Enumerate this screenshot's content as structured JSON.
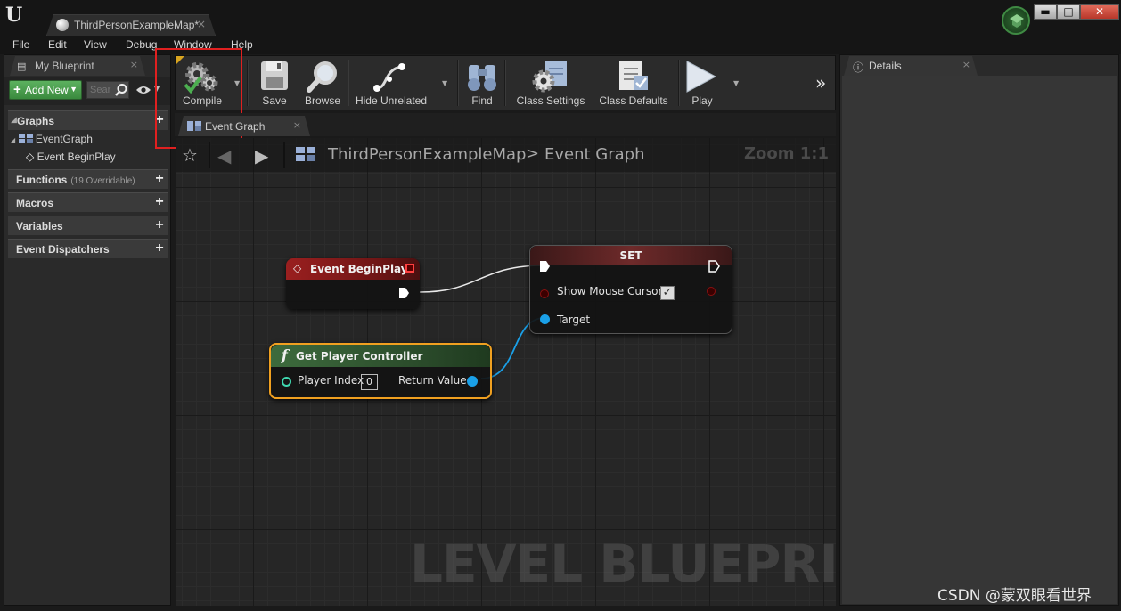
{
  "window": {
    "tab_title": "ThirdPersonExampleMap*",
    "tab_close": "×",
    "controls": {
      "minimize": "▬",
      "maximize": "□",
      "close": "✕"
    }
  },
  "menu": [
    "File",
    "Edit",
    "View",
    "Debug",
    "Window",
    "Help"
  ],
  "left_panel": {
    "tab_title": "My Blueprint",
    "tab_close": "×",
    "add_new_label": "Add New",
    "search_placeholder": "Sear",
    "sections": {
      "graphs": "Graphs",
      "functions": "Functions",
      "functions_sub": "(19 Overridable)",
      "macros": "Macros",
      "variables": "Variables",
      "event_dispatchers": "Event Dispatchers"
    },
    "tree": {
      "event_graph": "EventGraph",
      "event_beginplay": "Event BeginPlay"
    }
  },
  "toolbar": {
    "compile": "Compile",
    "save": "Save",
    "browse": "Browse",
    "hide_unrelated": "Hide Unrelated",
    "find": "Find",
    "class_settings": "Class Settings",
    "class_defaults": "Class Defaults",
    "play": "Play",
    "overflow": "»"
  },
  "graph": {
    "tab_title": "Event Graph",
    "tab_close": "×",
    "breadcrumb_root": "ThirdPersonExampleMap",
    "breadcrumb_sep": ">",
    "breadcrumb_leaf": "Event Graph",
    "zoom": "Zoom 1:1",
    "watermark": "LEVEL BLUEPRINT"
  },
  "nodes": {
    "begin_play": {
      "title": "Event BeginPlay"
    },
    "set": {
      "title": "SET",
      "pin_show_mouse": "Show Mouse Cursor",
      "show_mouse_checked": true,
      "pin_target": "Target"
    },
    "get_pc": {
      "title": "Get Player Controller",
      "pin_player_index": "Player Index",
      "player_index_value": "0",
      "pin_return": "Return Value"
    }
  },
  "details_panel": {
    "tab_title": "Details",
    "tab_close": "×"
  },
  "overlay": {
    "csdn": "CSDN @蒙双眼看世界"
  },
  "colors": {
    "exec_wire": "#e8e8e8",
    "object_pin": "#1aa0e8",
    "bool_pin": "#8a1010",
    "highlight": "#e02020",
    "selected_node": "#f0a020"
  }
}
